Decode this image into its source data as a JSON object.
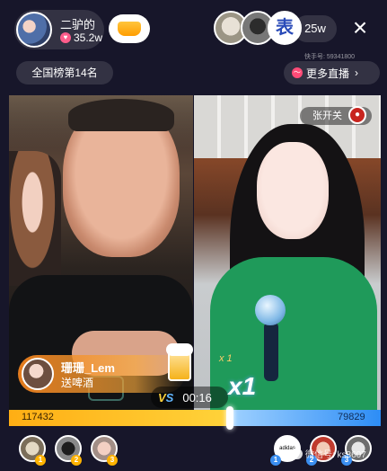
{
  "header": {
    "host_name": "二驴的",
    "host_heat": "35.2w",
    "viewer_count": "25w",
    "viewer_3_badge": "表",
    "close_glyph": "×",
    "kuaishou_id": "快手号: 59341800"
  },
  "rank": {
    "label": "全国榜第14名"
  },
  "more_live": {
    "label": "更多直播",
    "chevron": "›"
  },
  "guest": {
    "name": "张开关"
  },
  "gift": {
    "user": "珊珊_Lem",
    "action": "送啤酒",
    "multiplier_top": "x 1",
    "multiplier": "x1"
  },
  "pk": {
    "timer": "00:16",
    "left_score": "117432",
    "right_score": "79829",
    "left_share": 0.595,
    "vs_v": "V",
    "vs_s": "S"
  },
  "bottom": {
    "left_ranks": [
      "1",
      "2",
      "3"
    ],
    "right_ranks": [
      "1",
      "2",
      "3"
    ],
    "right_rank_1_text": "adidas",
    "watermark": "微信号: ks3607"
  },
  "colors": {
    "background": "#17162a",
    "pk_left": "#ffc428",
    "pk_right": "#3a8ef0",
    "gift_banner": "#f0821e"
  }
}
